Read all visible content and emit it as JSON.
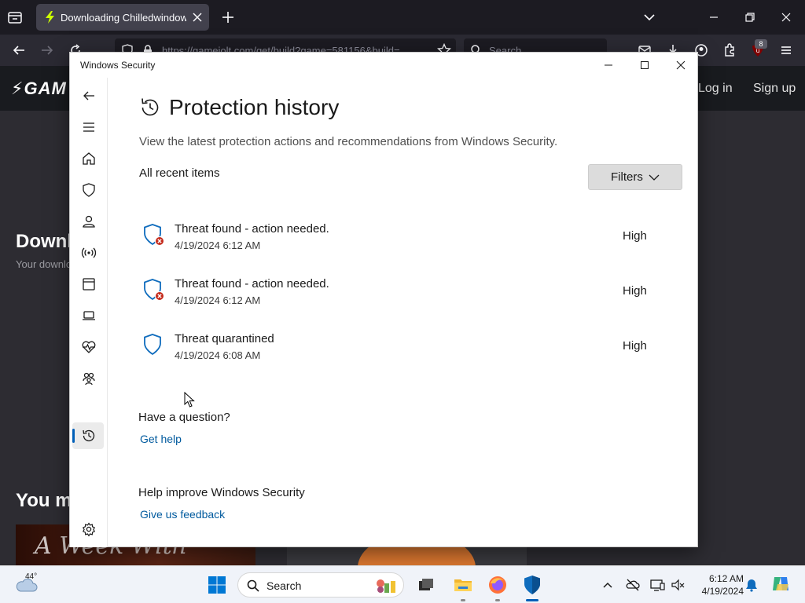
{
  "browser": {
    "tab": {
      "title": "Downloading Chilledwindows.e",
      "favicon": "lightning-favicon-icon"
    },
    "url": "https://gamejolt.com/get/build?game=581156&build=",
    "search_placeholder": "Search",
    "extension_badge": "8"
  },
  "webpage": {
    "logo_text": "GAM",
    "login": "Log in",
    "signup": "Sign up",
    "heading": "Downl",
    "subtext": "Your downlo",
    "section_heading": "You m",
    "thumbnail_text": "A Week With"
  },
  "window": {
    "title": "Windows Security",
    "nav_items": [
      {
        "name": "back-icon"
      },
      {
        "name": "menu-icon"
      },
      {
        "name": "home-icon"
      },
      {
        "name": "virus-threat-protection-icon"
      },
      {
        "name": "account-protection-icon"
      },
      {
        "name": "firewall-network-icon"
      },
      {
        "name": "app-browser-control-icon"
      },
      {
        "name": "device-security-icon"
      },
      {
        "name": "device-performance-health-icon"
      },
      {
        "name": "family-options-icon"
      },
      {
        "name": "protection-history-icon",
        "active": true
      },
      {
        "name": "settings-icon"
      }
    ]
  },
  "page": {
    "title": "Protection history",
    "description": "View the latest protection actions and recommendations from Windows Security.",
    "section_title": "All recent items",
    "filters_label": "Filters",
    "items": [
      {
        "title": "Threat found - action needed.",
        "date": "4/19/2024 6:12 AM",
        "severity": "High",
        "icon": "shield-error-icon"
      },
      {
        "title": "Threat found - action needed.",
        "date": "4/19/2024 6:12 AM",
        "severity": "High",
        "icon": "shield-error-icon"
      },
      {
        "title": "Threat quarantined",
        "date": "4/19/2024 6:08 AM",
        "severity": "High",
        "icon": "shield-icon"
      }
    ],
    "question_heading": "Have a question?",
    "get_help": "Get help",
    "improve_heading": "Help improve Windows Security",
    "feedback": "Give us feedback"
  },
  "taskbar": {
    "temperature": "44°",
    "search_label": "Search",
    "time": "6:12 AM",
    "date": "4/19/2024"
  },
  "colors": {
    "accent": "#005fb8",
    "link": "#005a9e",
    "shield_blue": "#0f6cbd",
    "error_red": "#c42b1c",
    "browser_dark": "#1c1b22"
  }
}
